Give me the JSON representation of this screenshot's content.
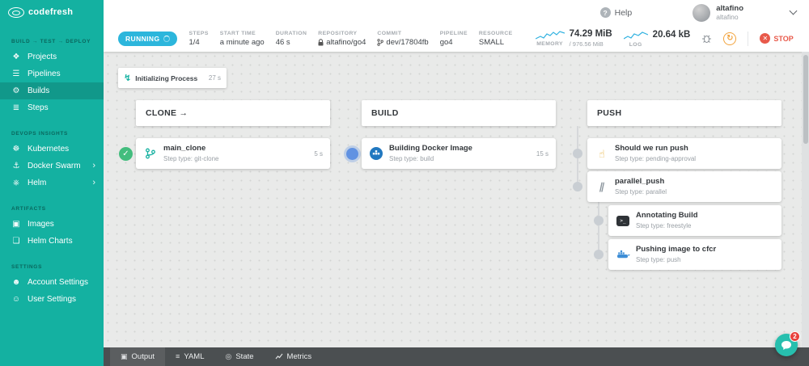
{
  "colors": {
    "sidebar_teal": "#14b1a1",
    "running_blue": "#2cb6dc",
    "success_green": "#43bd7e",
    "progress_blue": "#6192e2",
    "pending_gray": "#c9ced3",
    "stop_red": "#e8594a",
    "restart_orange": "#f2a33c",
    "chat_teal": "#27bfae"
  },
  "icons": {
    "projects": "❖",
    "pipelines": "☰",
    "builds": "⚙",
    "steps": "≣",
    "kubernetes": "☸",
    "docker_swarm": "⚓",
    "helm": "⎈",
    "images": "▣",
    "helm_charts": "❏",
    "account_settings": "☻",
    "user_settings": "☺",
    "chevron_right": "›",
    "help_q": "?",
    "check": "✓",
    "restart": "↻",
    "stop_x": "✕",
    "menu_dots": "⋮",
    "init": "↯",
    "parallel": "∥",
    "approval": "☝",
    "terminal_prompt": ">_",
    "output": "▣",
    "yaml": "≡",
    "state": "◎"
  },
  "sidebar": {
    "logo_text": "codefresh",
    "sections": [
      {
        "header": "BUILD → TEST → DEPLOY",
        "items": [
          {
            "label": "Projects"
          },
          {
            "label": "Pipelines"
          },
          {
            "label": "Builds"
          },
          {
            "label": "Steps"
          }
        ]
      },
      {
        "header": "DEVOPS INSIGHTS",
        "items": [
          {
            "label": "Kubernetes"
          },
          {
            "label": "Docker Swarm"
          },
          {
            "label": "Helm"
          }
        ]
      },
      {
        "header": "ARTIFACTS",
        "items": [
          {
            "label": "Images"
          },
          {
            "label": "Helm Charts"
          }
        ]
      },
      {
        "header": "SETTINGS",
        "items": [
          {
            "label": "Account Settings"
          },
          {
            "label": "User Settings"
          }
        ]
      }
    ]
  },
  "topbar": {
    "help": "Help",
    "user_name": "altafino",
    "user_account": "altafino"
  },
  "statusbar": {
    "status": "RUNNING",
    "fields": [
      {
        "label": "STEPS",
        "value": "1/4"
      },
      {
        "label": "START TIME",
        "value": "a minute ago"
      },
      {
        "label": "DURATION",
        "value": "46 s"
      },
      {
        "label": "REPOSITORY",
        "value": "altafino/go4"
      },
      {
        "label": "COMMIT",
        "value": "dev/17804fb"
      },
      {
        "label": "PIPELINE",
        "value": "go4"
      },
      {
        "label": "RESOURCE",
        "value": "SMALL"
      }
    ],
    "memory_label": "MEMORY",
    "memory_value": "74.29 MiB",
    "memory_total": "/ 976.56 MiB",
    "log_label": "LOG",
    "log_value": "20.64 kB",
    "stop_label": "STOP"
  },
  "pipeline": {
    "init": {
      "title": "Initializing Process",
      "duration": "27 s"
    },
    "stages": [
      {
        "title": "CLONE →"
      },
      {
        "title": "BUILD"
      },
      {
        "title": "PUSH"
      }
    ],
    "steps": {
      "clone": {
        "title": "main_clone",
        "subtitle": "Step type: git-clone",
        "duration": "5 s",
        "state": "success"
      },
      "build": {
        "title": "Building Docker Image",
        "subtitle": "Step type: build",
        "duration": "15 s",
        "state": "running"
      },
      "push_approval": {
        "title": "Should we run push",
        "subtitle": "Step type: pending-approval",
        "state": "pending"
      },
      "push_parallel": {
        "title": "parallel_push",
        "subtitle": "Step type: parallel",
        "state": "pending"
      },
      "push_annotate": {
        "title": "Annotating Build",
        "subtitle": "Step type: freestyle",
        "state": "pending"
      },
      "push_image": {
        "title": "Pushing image to cfcr",
        "subtitle": "Step type: push",
        "state": "pending"
      }
    }
  },
  "bottombar": {
    "tabs": [
      {
        "label": "Output"
      },
      {
        "label": "YAML"
      },
      {
        "label": "State"
      },
      {
        "label": "Metrics"
      }
    ]
  },
  "chat": {
    "badge": "2"
  }
}
